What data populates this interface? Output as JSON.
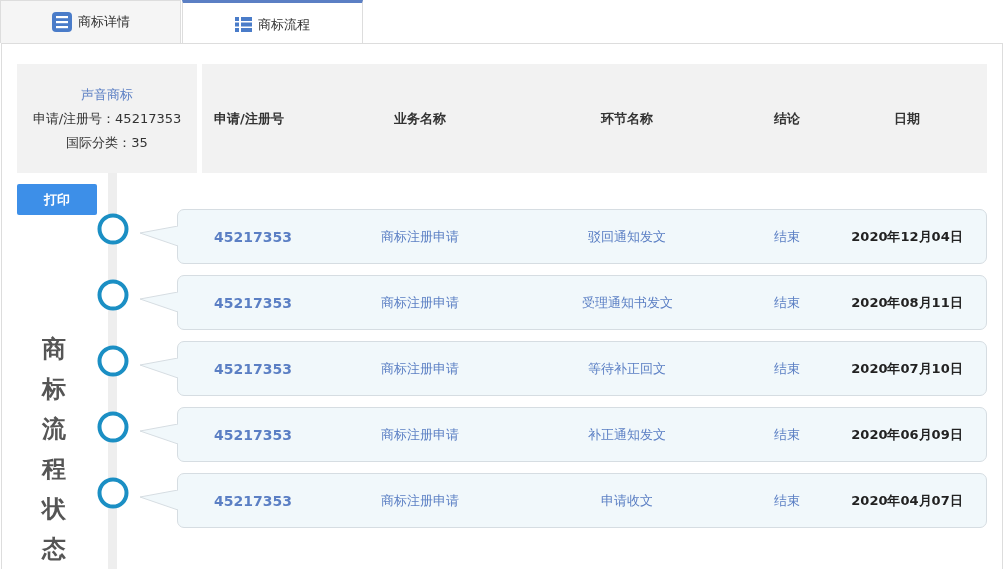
{
  "tabs": [
    {
      "label": "商标详情",
      "selected": false
    },
    {
      "label": "商标流程",
      "selected": true
    }
  ],
  "summary": {
    "type": "声音商标",
    "reg_no": "申请/注册号：45217353",
    "class": "国际分类：35"
  },
  "columns": [
    "申请/注册号",
    "业务名称",
    "环节名称",
    "结论",
    "日期"
  ],
  "print_button": "打印",
  "vertical_title": "商标流程状态",
  "rows": [
    {
      "reg_no": "45217353",
      "business": "商标注册申请",
      "step": "驳回通知发文",
      "conclusion": "结束",
      "date": "2020年12月04日"
    },
    {
      "reg_no": "45217353",
      "business": "商标注册申请",
      "step": "受理通知书发文",
      "conclusion": "结束",
      "date": "2020年08月11日"
    },
    {
      "reg_no": "45217353",
      "business": "商标注册申请",
      "step": "等待补正回文",
      "conclusion": "结束",
      "date": "2020年07月10日"
    },
    {
      "reg_no": "45217353",
      "business": "商标注册申请",
      "step": "补正通知发文",
      "conclusion": "结束",
      "date": "2020年06月09日"
    },
    {
      "reg_no": "45217353",
      "business": "商标注册申请",
      "step": "申请收文",
      "conclusion": "结束",
      "date": "2020年04月07日"
    }
  ]
}
